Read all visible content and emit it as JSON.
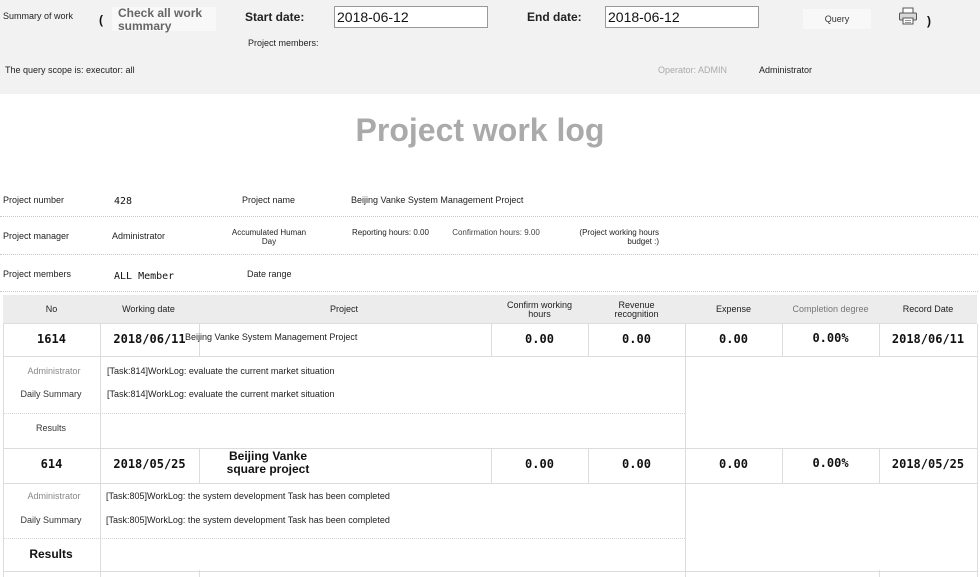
{
  "toolbar": {
    "summary_label": "Summary of work",
    "open_paren": "(",
    "close_paren": ")",
    "check_all_label": "Check all work summary",
    "start_label": "Start date:",
    "start_value": "2018-06-12",
    "end_label": "End date:",
    "end_value": "2018-06-12",
    "members_label": "Project members:",
    "query_label": "Query",
    "print_icon": "printer-icon",
    "scope_text": "The query scope is: executor: all",
    "operator_text": "Operator: ADMIN",
    "operator_name": "Administrator"
  },
  "title": "Project work log",
  "info": {
    "project_number_label": "Project number",
    "project_number": "428",
    "project_name_label": "Project name",
    "project_name": "Beijing Vanke System Management Project",
    "manager_label": "Project manager",
    "manager": "Administrator",
    "accum_label": "Accumulated Human Day",
    "reporting_label": "Reporting hours: 0.00",
    "confirmation_label": "Confirmation hours: 9.00",
    "budget_label": "(Project working hours budget :)",
    "members_label": "Project members",
    "members": "ALL Member",
    "date_range_label": "Date range"
  },
  "table": {
    "headers": {
      "no": "No",
      "working_date": "Working date",
      "project": "Project",
      "confirm_hours": "Confirm working hours",
      "revenue": "Revenue recognition",
      "expense": "Expense",
      "completion": "Completion degree",
      "record_date": "Record Date"
    },
    "rows": [
      {
        "no": "1614",
        "working_date": "2018/06/11",
        "project": "Beijing Vanke System Management Project",
        "confirm_hours": "0.00",
        "revenue": "0.00",
        "expense": "0.00",
        "completion": "0.00%",
        "record_date": "2018/06/11",
        "user": "Administrator",
        "log_1": "[Task:814]WorkLog: evaluate the current market situation",
        "daily_label": "Daily Summary",
        "log_2": "[Task:814]WorkLog: evaluate the current market situation",
        "results_label": "Results"
      },
      {
        "no": "614",
        "working_date": "2018/05/25",
        "project": "Beijing Vanke square project",
        "confirm_hours": "0.00",
        "revenue": "0.00",
        "expense": "0.00",
        "completion": "0.00%",
        "record_date": "2018/05/25",
        "user": "Administrator",
        "log_1": "[Task:805]WorkLog: the system development Task has been completed",
        "daily_label": "Daily Summary",
        "log_2": "[Task:805]WorkLog: the system development Task has been completed",
        "results_label": "Results"
      }
    ]
  }
}
